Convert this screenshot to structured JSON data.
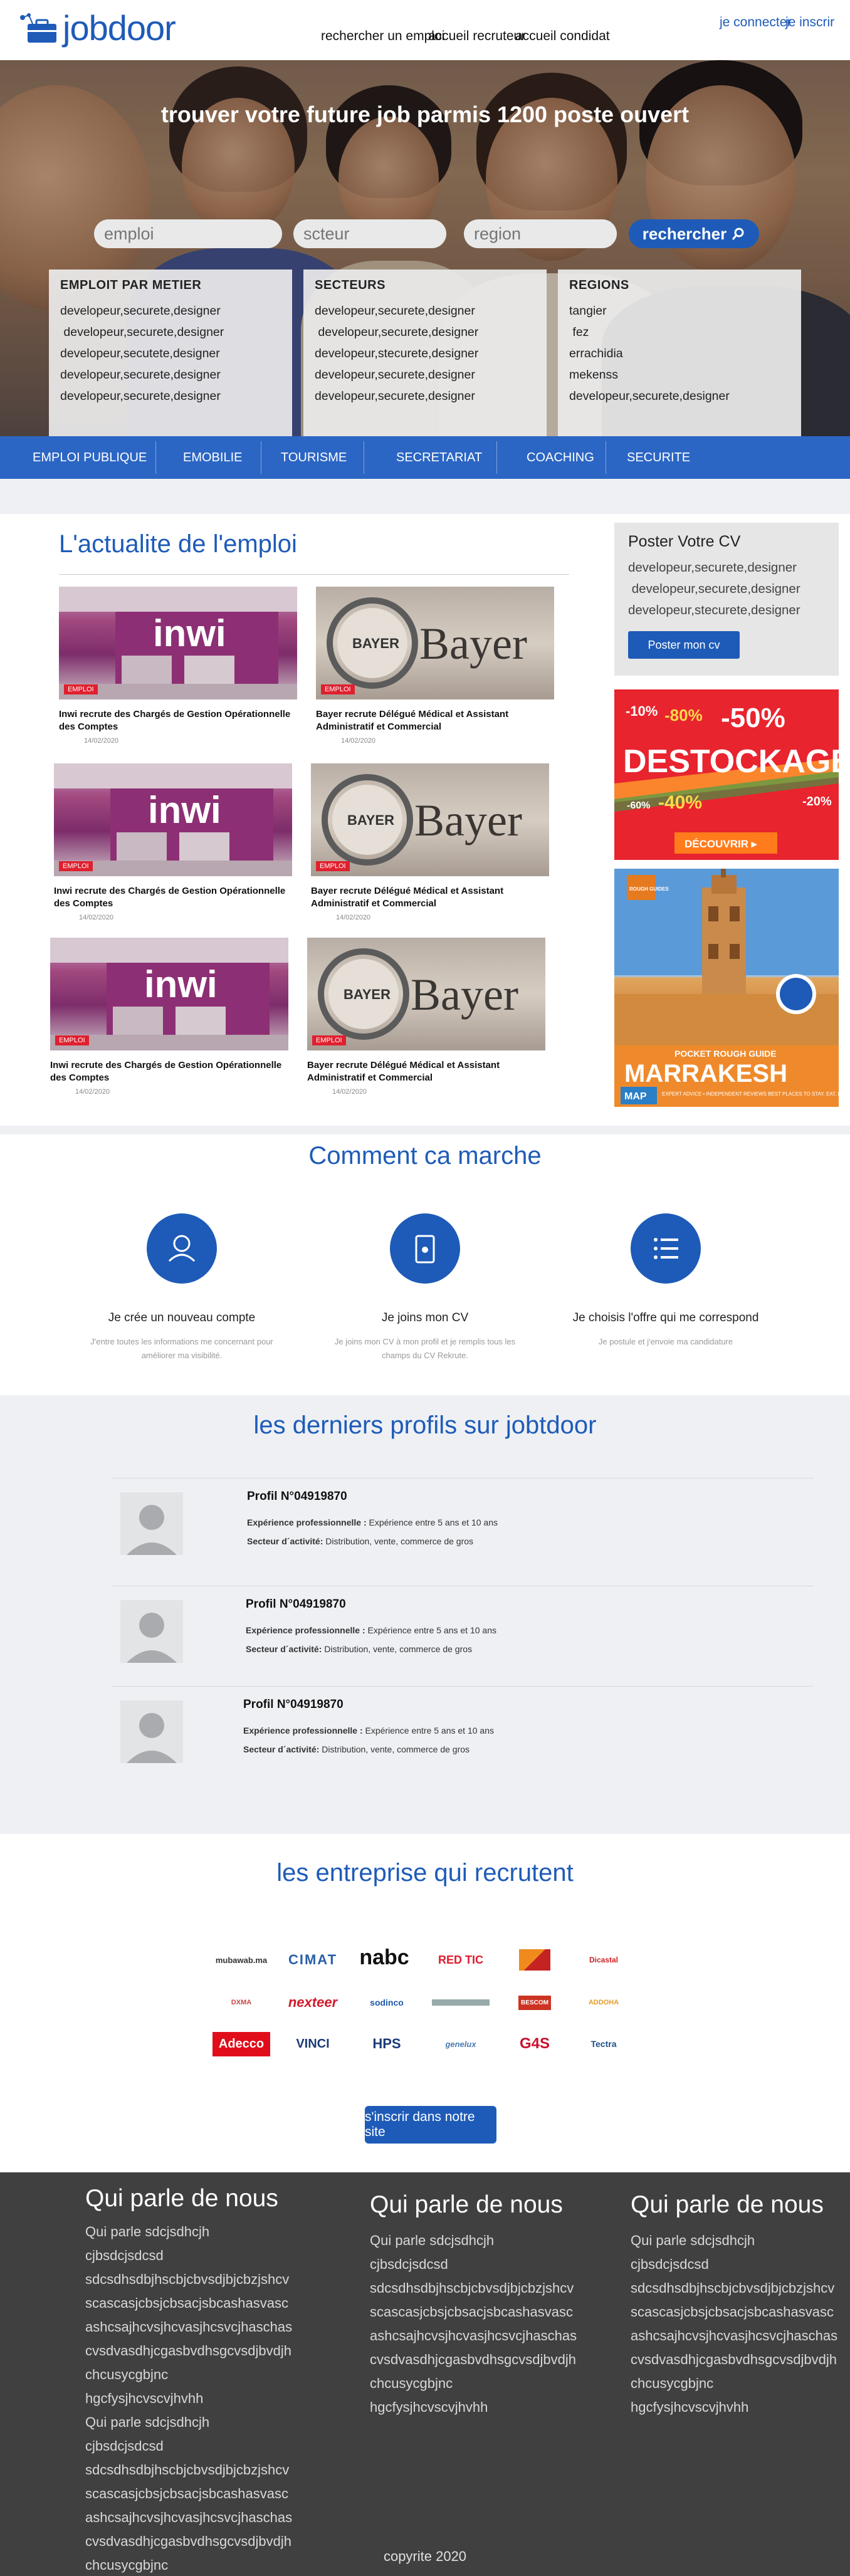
{
  "header": {
    "logo_text": "jobdoor",
    "nav": [
      "rechercher un emploi",
      "accueil recruteur",
      "accueil condidat"
    ],
    "auth": [
      "je connecter",
      "je inscrir"
    ]
  },
  "hero": {
    "title": "trouver votre future job  parmis 1200 poste ouvert",
    "search": {
      "emploi_placeholder": "emploi",
      "secteur_placeholder": "scteur",
      "region_placeholder": "region",
      "button": "rechercher"
    },
    "boxes": [
      {
        "title": "EMPLOIT PAR METIER",
        "items": [
          "developeur,securete,designer",
          " developeur,securete,designer",
          "developeur,secutete,designer",
          "developeur,securete,designer",
          "developeur,securete,designer"
        ]
      },
      {
        "title": "SECTEURS",
        "items": [
          "developeur,securete,designer",
          " developeur,securete,designer",
          "developeur,stecurete,designer",
          "developeur,securete,designer",
          "developeur,securete,designer"
        ]
      },
      {
        "title": "REGIONS",
        "items": [
          "tangier",
          " fez",
          "errachidia",
          "mekenss",
          "developeur,securete,designer"
        ]
      }
    ]
  },
  "categories": [
    "EMPLOI PUBLIQUE",
    "EMOBILIE",
    "TOURISME",
    "SECRETARIAT",
    "COACHING",
    "SECURITE"
  ],
  "news": {
    "title": "L'actualite de l'emploi",
    "badge": "EMPLOI",
    "cards": [
      {
        "brand": "inwi",
        "title": "Inwi recrute des Chargés de Gestion Opérationnelle des Comptes",
        "date": "14/02/2020"
      },
      {
        "brand": "Bayer",
        "title": "Bayer recrute Délégué Médical et Assistant Administratif et Commercial",
        "date": "14/02/2020"
      },
      {
        "brand": "inwi",
        "title": "Inwi recrute des Chargés de Gestion Opérationnelle des Comptes",
        "date": "14/02/2020"
      },
      {
        "brand": "Bayer",
        "title": "Bayer recrute Délégué Médical et Assistant Administratif et Commercial",
        "date": "14/02/2020"
      },
      {
        "brand": "inwi",
        "title": "Inwi recrute des Chargés de Gestion Opérationnelle des Comptes",
        "date": "14/02/2020"
      },
      {
        "brand": "Bayer",
        "title": "Bayer recrute Délégué Médical et Assistant Administratif et Commercial",
        "date": "14/02/2020"
      }
    ]
  },
  "sidebar": {
    "cv_title": "Poster Votre CV",
    "cv_lines": [
      "developeur,securete,designer",
      " developeur,securete,designer",
      "developeur,stecurete,designer"
    ],
    "cv_button": "Poster mon cv",
    "ad1": {
      "headline": "DESTOCKAGE",
      "big": "-50%",
      "tags": [
        "-10%",
        "-80%",
        "-40%",
        "-20%",
        "-60%"
      ],
      "button": "DÉCOUVRIR ▸"
    },
    "ad2": {
      "brand": "ROUGH GUIDES",
      "kicker": "POCKET ROUGH GUIDE",
      "city": "MARRAKESH",
      "map": "MAP",
      "tagline": "EXPERT ADVICE • INDEPENDENT REVIEWS BEST PLACES TO STAY, EAT, DRINK & SHOP"
    }
  },
  "how": {
    "title": "Comment ca marche",
    "steps": [
      {
        "icon": "user-icon",
        "title": "Je crée un nouveau compte",
        "desc": "J'entre toutes les informations me concernant pour améliorer ma visibilité."
      },
      {
        "icon": "phone-icon",
        "title": "Je joins mon CV",
        "desc": "Je joins mon CV à mon profil et je remplis tous les champs du CV Rekrute."
      },
      {
        "icon": "list-icon",
        "title": "Je choisis l'offre qui me correspond",
        "desc": "Je postule et j'envoie ma candidature"
      }
    ]
  },
  "profiles": {
    "title": "les derniers profils sur jobtdoor",
    "items": [
      {
        "name": "Profil N°04919870",
        "exp_label": "Expérience professionnelle :",
        "exp": " Expérience entre 5 ans et 10 ans",
        "sector_label": "Secteur d´activité:",
        "sector": " Distribution, vente, commerce de gros"
      },
      {
        "name": "Profil N°04919870",
        "exp_label": "Expérience professionnelle :",
        "exp": " Expérience entre 5 ans et 10 ans",
        "sector_label": "Secteur d´activité:",
        "sector": " Distribution, vente, commerce de gros"
      },
      {
        "name": "Profil N°04919870",
        "exp_label": "Expérience professionnelle :",
        "exp": " Expérience entre 5 ans et 10 ans",
        "sector_label": "Secteur d´activité:",
        "sector": " Distribution, vente, commerce de gros"
      }
    ]
  },
  "companies": {
    "title": "les entreprise qui recrutent",
    "logos": [
      "mubawab.ma",
      "CIMAT",
      "nabc",
      "RED TIC",
      "",
      "Dicastal",
      "DXMA",
      "nexteer",
      "sodinco",
      "",
      "BESCOM",
      "ADDOHA",
      "Adecco",
      "VINCI",
      "HPS",
      "genelux",
      "G4S",
      "Tectra"
    ],
    "button": "s'inscrir dans notre site"
  },
  "footer": {
    "columns": [
      {
        "title": "Qui parle de nous",
        "lines": [
          "Qui parle sdcjsdhcjh cjbsdcjsdcsd",
          "sdcsdhsdbjhscbjcbvsdjbjcbzjshcv",
          "scascasjcbsjcbsacjsbcashasvasc",
          "ashcsajhcvsjhcvasjhcsvcjhaschas",
          "cvsdvasdhjcgasbvdhsgcvsdjbvdjh",
          "chcusycgbjnc hgcfysjhcvscvjhvhh",
          "Qui parle sdcjsdhcjh cjbsdcjsdcsd",
          "sdcsdhsdbjhscbjcbvsdjbjcbzjshcv",
          "scascasjcbsjcbsacjsbcashasvasc",
          "ashcsajhcvsjhcvasjhcsvcjhaschas",
          "cvsdvasdhjcgasbvdhsgcvsdjbvdjh",
          "chcusycgbjnc hgcfysjhcvscvjhvhh"
        ]
      },
      {
        "title": "Qui parle de nous",
        "lines": [
          "Qui parle sdcjsdhcjh cjbsdcjsdcsd",
          "sdcsdhsdbjhscbjcbvsdjbjcbzjshcv",
          "scascasjcbsjcbsacjsbcashasvasc",
          "ashcsajhcvsjhcvasjhcsvcjhaschas",
          "cvsdvasdhjcgasbvdhsgcvsdjbvdjh",
          "chcusycgbjnc hgcfysjhcvscvjhvhh"
        ]
      },
      {
        "title": "Qui parle de nous",
        "lines": [
          "Qui parle sdcjsdhcjh cjbsdcjsdcsd",
          "sdcsdhsdbjhscbjcbvsdjbjcbzjshcv",
          "scascasjcbsjcbsacjsbcashasvasc",
          "ashcsajhcvsjhcvasjhcsvcjhaschas",
          "cvsdvasdhjcgasbvdhsgcvsdjbvdjh",
          "chcusycgbjnc hgcfysjhcvscvjhvhh"
        ]
      }
    ],
    "copyright": "copyrite 2020"
  },
  "colors": {
    "brand": "#1e5bb8",
    "catbar": "#2c66c4",
    "footer": "#404040",
    "badge": "#e0202e"
  }
}
